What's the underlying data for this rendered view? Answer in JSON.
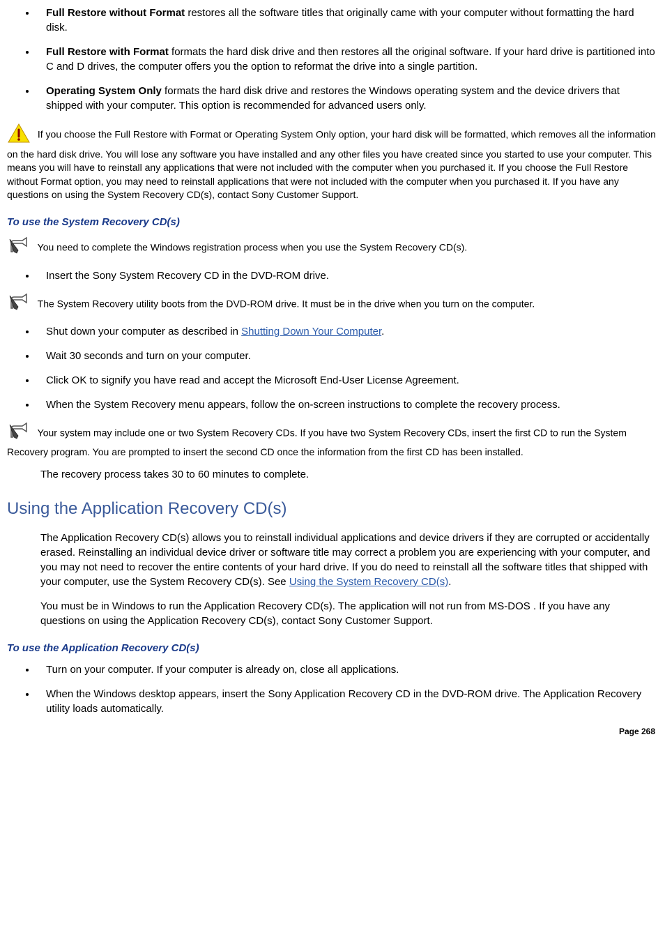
{
  "options": [
    {
      "title": "Full Restore without Format",
      "desc": " restores all the software titles that originally came with your computer without formatting the hard disk."
    },
    {
      "title": "Full Restore with Format",
      "desc": " formats the hard disk drive and then restores all the original software. If your hard drive is partitioned into C and D drives, the computer offers you the option to reformat the drive into a single partition."
    },
    {
      "title": "Operating System Only",
      "desc": " formats the hard disk drive and restores the Windows operating system and the device drivers that shipped with your computer. This option is recommended for advanced users only."
    }
  ],
  "warning1": " If you choose the Full Restore with Format or Operating System Only option, your hard disk will be formatted, which removes all the information on the hard disk drive. You will lose any software you have installed and any other files you have created since you started to use your computer. This means you will have to reinstall any applications that were not included with the computer when you purchased it. If you choose the Full Restore without Format option, you may need to reinstall applications that were not included with the computer when you purchased it. If you have any questions on using the System Recovery CD(s), contact Sony Customer Support.",
  "subheading1": "To use the System Recovery CD(s)",
  "note1": " You need to complete the Windows registration process when you use the System Recovery CD(s).",
  "step1": "Insert the Sony System Recovery CD in the DVD-ROM drive.",
  "note2": " The System Recovery utility boots from the DVD-ROM drive. It must be in the drive when you turn on the computer.",
  "steps2": {
    "a_pre": "Shut down your computer as described in ",
    "a_link": "Shutting Down Your Computer",
    "a_post": ".",
    "b": "Wait 30 seconds and turn on your computer.",
    "c": "Click OK to signify you have read and accept the Microsoft End-User License Agreement.",
    "d": "When the System Recovery menu appears, follow the on-screen instructions to complete the recovery process."
  },
  "note3": " Your system may include one or two System Recovery CDs. If you have two System Recovery CDs, insert the first CD to run the System Recovery program. You are prompted to insert the second CD once the information from the first CD has been installed.",
  "recovery_time": "The recovery process takes 30 to 60 minutes to complete.",
  "section2_heading": "Using the Application Recovery CD(s)",
  "section2_p1_pre": "The Application Recovery CD(s) allows you to reinstall individual applications and device drivers if they are corrupted or accidentally erased. Reinstalling an individual device driver or software title may correct a problem you are experiencing with your computer, and you may not need to recover the entire contents of your hard drive. If you do need to reinstall all the software titles that shipped with your computer, use the System Recovery CD(s). See ",
  "section2_p1_link": "Using the System Recovery CD(s)",
  "section2_p1_post": ".",
  "section2_p2": "You must be in Windows to run the Application Recovery CD(s). The application will not run from MS-DOS  . If you have any questions on using the Application Recovery CD(s), contact Sony Customer Support.",
  "subheading2": "To use the Application Recovery CD(s)",
  "app_steps": {
    "a": "Turn on your computer. If your computer is already on, close all applications.",
    "b": "When the Windows desktop appears, insert the Sony Application Recovery CD in the DVD-ROM drive. The Application Recovery utility loads automatically."
  },
  "page_number": "Page 268"
}
